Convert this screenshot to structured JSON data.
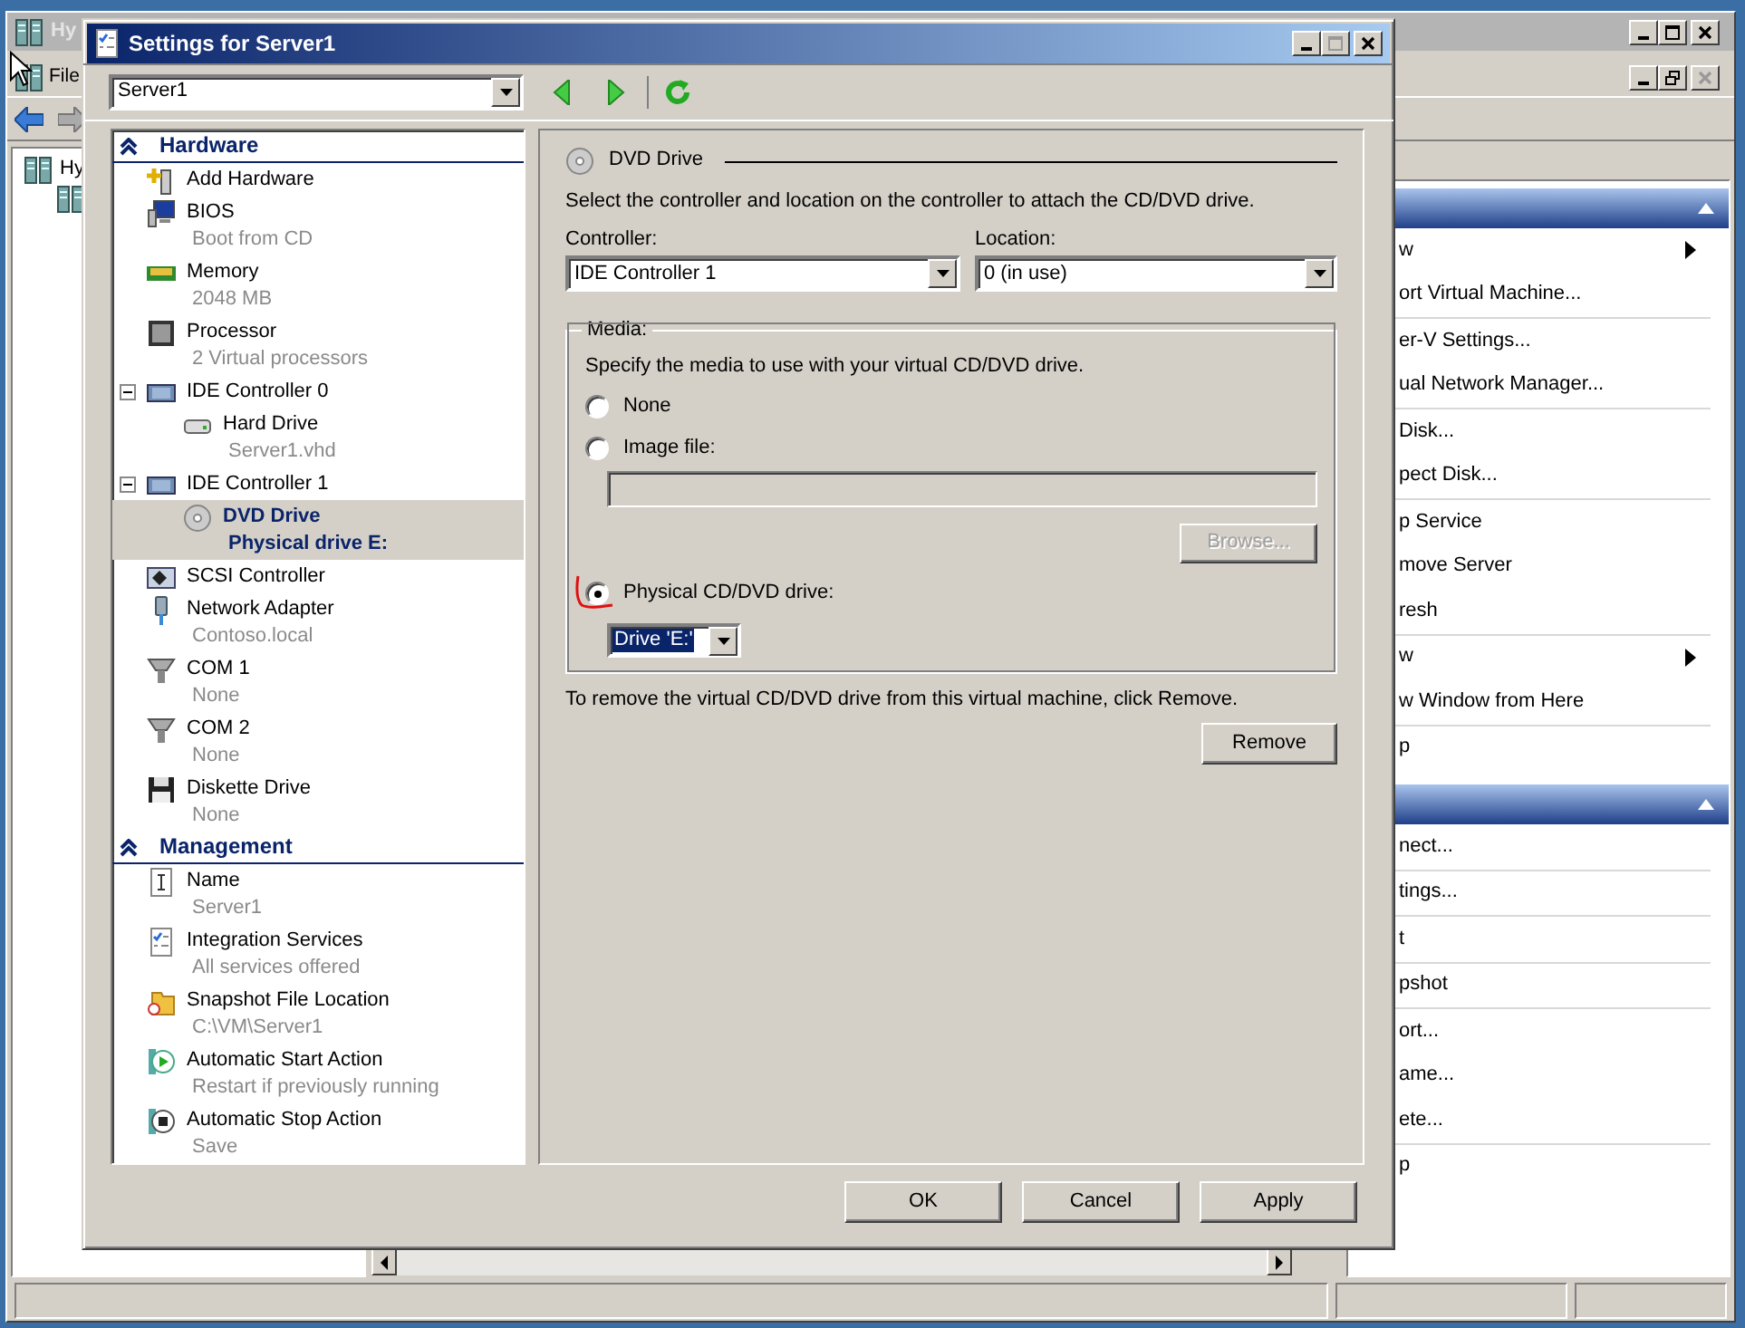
{
  "background_window": {
    "title": "Hy",
    "menu": [
      "File"
    ],
    "tree": [
      "Hy"
    ],
    "action_sections": [
      {
        "expanded": true,
        "groups": [
          [
            {
              "label": "w",
              "submenu": true
            },
            {
              "label": "ort Virtual Machine...",
              "submenu": false
            }
          ],
          [
            {
              "label": "er-V Settings...",
              "submenu": false
            },
            {
              "label": "ual Network Manager...",
              "submenu": false
            }
          ],
          [
            {
              "label": "Disk...",
              "submenu": false
            },
            {
              "label": "pect Disk...",
              "submenu": false
            }
          ],
          [
            {
              "label": "p Service",
              "submenu": false
            },
            {
              "label": "move Server",
              "submenu": false
            },
            {
              "label": "resh",
              "submenu": false
            }
          ],
          [
            {
              "label": "w",
              "submenu": true
            },
            {
              "label": "w Window from Here",
              "submenu": false
            }
          ],
          [
            {
              "label": "p",
              "submenu": false
            }
          ]
        ]
      },
      {
        "expanded": true,
        "groups": [
          [
            {
              "label": "nect...",
              "submenu": false
            }
          ],
          [
            {
              "label": "tings...",
              "submenu": false
            }
          ],
          [
            {
              "label": "t",
              "submenu": false
            }
          ],
          [
            {
              "label": "pshot",
              "submenu": false
            }
          ],
          [
            {
              "label": "ort...",
              "submenu": false
            },
            {
              "label": "ame...",
              "submenu": false
            },
            {
              "label": "ete...",
              "submenu": false
            }
          ],
          [
            {
              "label": "p",
              "submenu": false
            }
          ]
        ]
      }
    ]
  },
  "dialog": {
    "title": "Settings for Server1",
    "vm": "Server1",
    "sections": [
      {
        "title": "Hardware",
        "expanded": true,
        "items": [
          {
            "kind": "add",
            "label": "Add Hardware",
            "selected": false
          },
          {
            "kind": "bios",
            "label": "BIOS",
            "detail": "Boot from CD",
            "selected": false
          },
          {
            "kind": "memory",
            "label": "Memory",
            "detail": "2048 MB",
            "selected": false
          },
          {
            "kind": "processor",
            "label": "Processor",
            "detail": "2 Virtual processors",
            "selected": false
          },
          {
            "kind": "controller",
            "label": "IDE Controller 0",
            "selected": false,
            "expanded": true,
            "children": [
              {
                "kind": "disk",
                "label": "Hard Drive",
                "detail": "Server1.vhd",
                "selected": false
              }
            ]
          },
          {
            "kind": "controller",
            "label": "IDE Controller 1",
            "selected": false,
            "expanded": true,
            "children": [
              {
                "kind": "dvd",
                "label": "DVD Drive",
                "detail": "Physical drive E:",
                "selected": true
              }
            ]
          },
          {
            "kind": "scsi",
            "label": "SCSI Controller",
            "selected": false
          },
          {
            "kind": "network",
            "label": "Network Adapter",
            "detail": "Contoso.local",
            "selected": false
          },
          {
            "kind": "com",
            "label": "COM 1",
            "detail": "None",
            "selected": false
          },
          {
            "kind": "com",
            "label": "COM 2",
            "detail": "None",
            "selected": false
          },
          {
            "kind": "floppy",
            "label": "Diskette Drive",
            "detail": "None",
            "selected": false
          }
        ]
      },
      {
        "title": "Management",
        "expanded": true,
        "items": [
          {
            "kind": "name",
            "label": "Name",
            "detail": "Server1",
            "selected": false
          },
          {
            "kind": "services",
            "label": "Integration Services",
            "detail": "All services offered",
            "selected": false
          },
          {
            "kind": "folder",
            "label": "Snapshot File Location",
            "detail": "C:\\VM\\Server1",
            "selected": false
          },
          {
            "kind": "start",
            "label": "Automatic Start Action",
            "detail": "Restart if previously running",
            "selected": false
          },
          {
            "kind": "stop",
            "label": "Automatic Stop Action",
            "detail": "Save",
            "selected": false
          }
        ]
      }
    ],
    "page": {
      "title": "DVD Drive",
      "intro": "Select the controller and location on the controller to attach the CD/DVD drive.",
      "controller_label": "Controller:",
      "controller": "IDE Controller 1",
      "location_label": "Location:",
      "location": "0 (in use)",
      "media_legend": "Media:",
      "media_hint": "Specify the media to use with your virtual CD/DVD drive.",
      "options": [
        {
          "label": "None",
          "selected": false
        },
        {
          "label": "Image file:",
          "selected": false
        },
        {
          "label": "Physical CD/DVD drive:",
          "selected": true
        }
      ],
      "image_path": {
        "disabled": true
      },
      "browse": {
        "label": "Browse...",
        "disabled": true
      },
      "drive": "Drive 'E:'",
      "remove_text": "To remove the virtual CD/DVD drive from this virtual machine, click Remove.",
      "remove": "Remove"
    },
    "buttons": [
      "OK",
      "Cancel",
      "Apply"
    ]
  }
}
